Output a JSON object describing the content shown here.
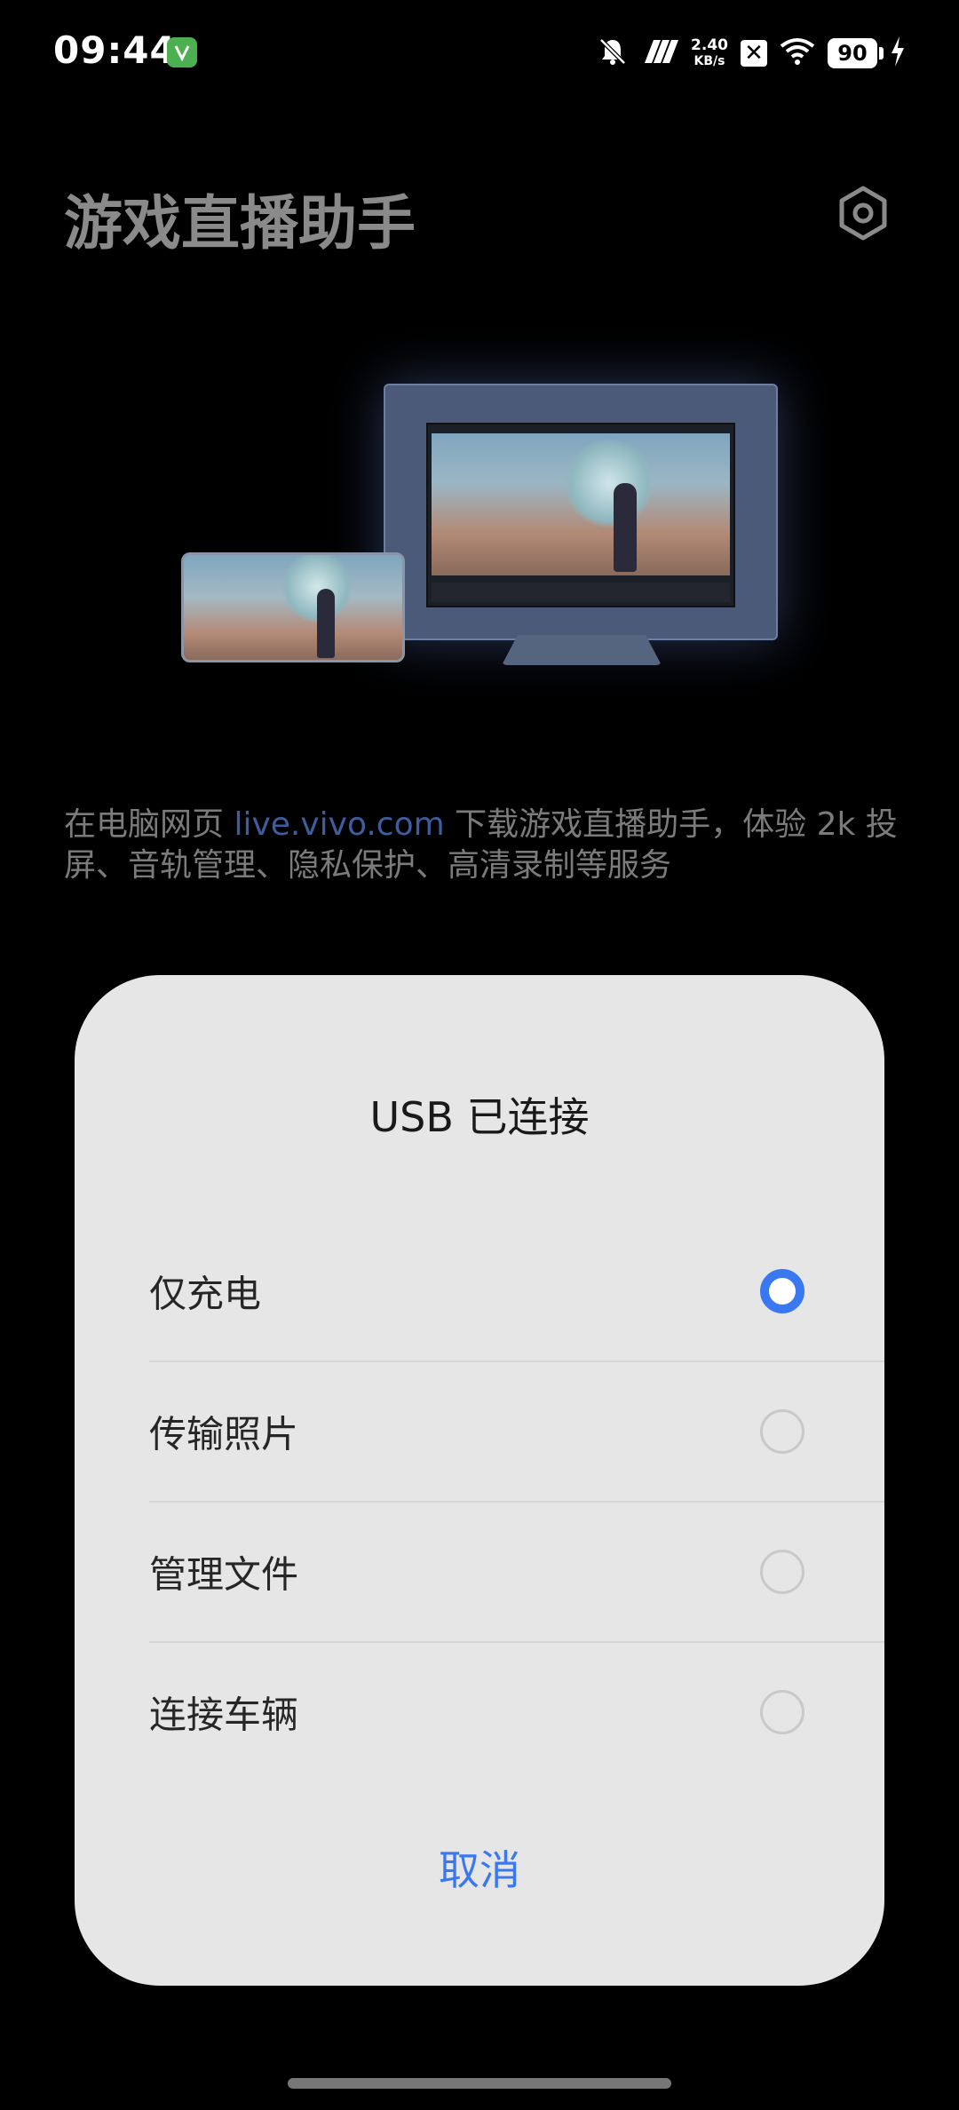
{
  "status_bar": {
    "time": "09:44",
    "net_speed_value": "2.40",
    "net_speed_unit": "KB/s",
    "battery": "90",
    "icons": [
      "app-badge-icon",
      "mute-bell-icon",
      "signal-icon",
      "x-icon",
      "wifi-icon",
      "battery-icon",
      "charging-bolt-icon"
    ]
  },
  "header": {
    "title": "游戏直播助手",
    "settings_icon": "gear-hexagon-icon"
  },
  "description": {
    "prefix": "在电脑网页 ",
    "link": "live.vivo.com",
    "suffix": " 下载游戏直播助手，体验 2k 投屏、音轨管理、隐私保护、高清录制等服务"
  },
  "dialog": {
    "title": "USB 已连接",
    "options": [
      {
        "label": "仅充电",
        "selected": true
      },
      {
        "label": "传输照片",
        "selected": false
      },
      {
        "label": "管理文件",
        "selected": false
      },
      {
        "label": "连接车辆",
        "selected": false
      }
    ],
    "cancel": "取消"
  },
  "colors": {
    "accent": "#3a78f2",
    "dialog_bg": "#e6e6e6",
    "link": "#3d5d9e"
  }
}
